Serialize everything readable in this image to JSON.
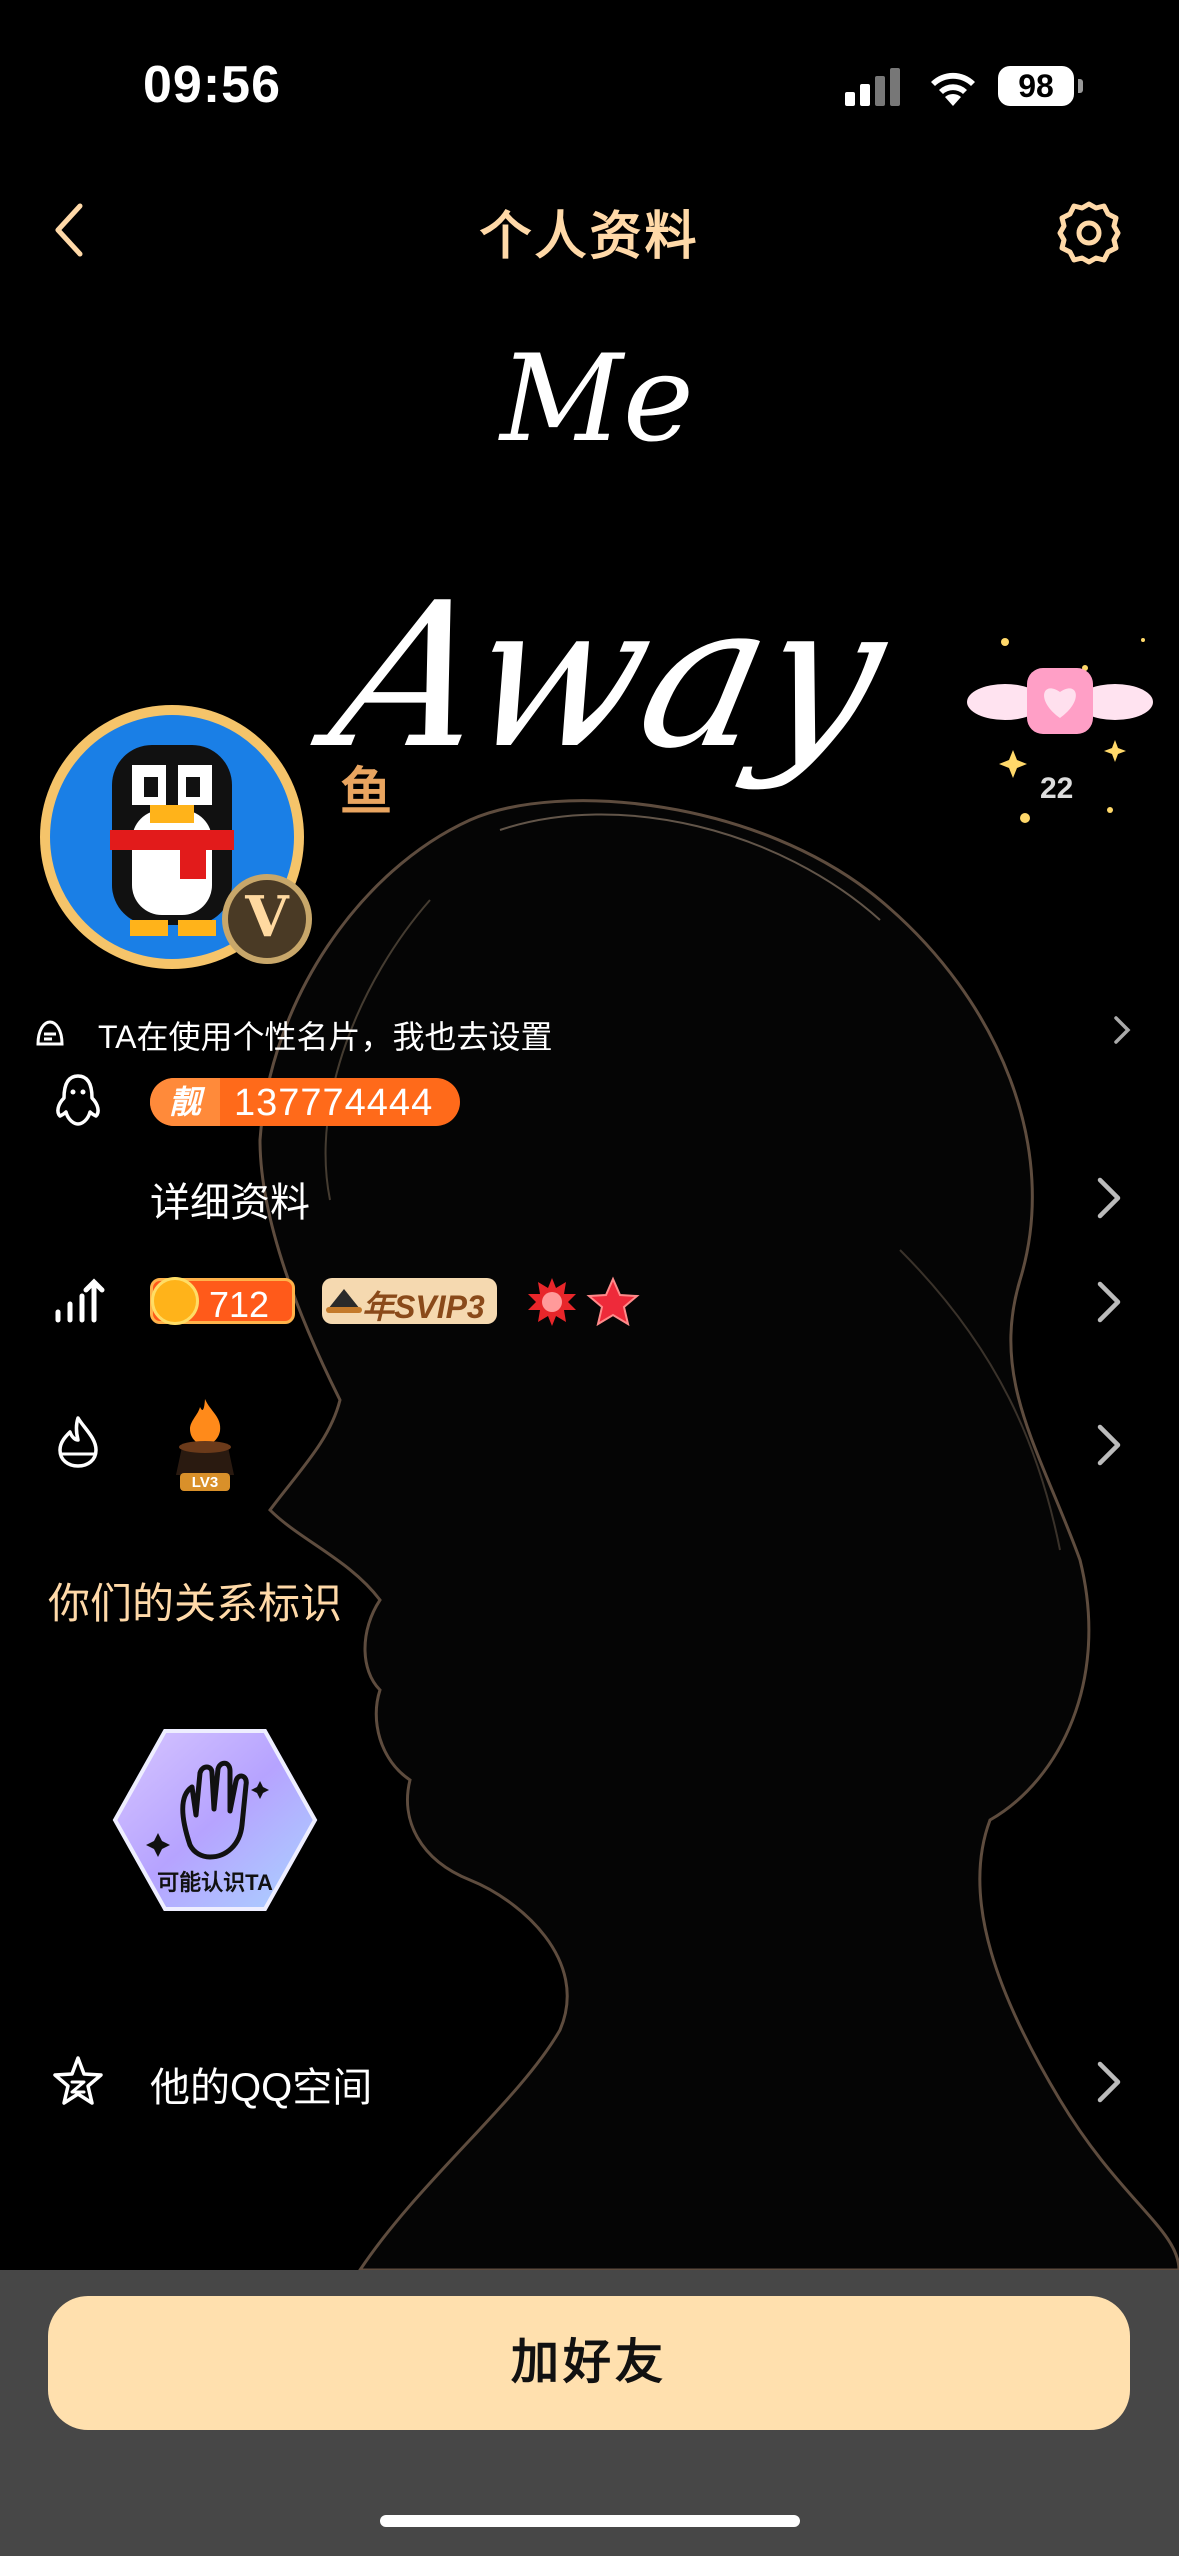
{
  "status_bar": {
    "time": "09:56",
    "battery": "98"
  },
  "header": {
    "title": "个人资料"
  },
  "hero": {
    "script_line1": "Me",
    "script_line2": "Away"
  },
  "profile": {
    "nickname": "鱼",
    "vip_letter": "V"
  },
  "gift": {
    "count": "22"
  },
  "card_hint": {
    "text": "TA在使用个性名片，我也去设置"
  },
  "qq_row": {
    "tag": "靓",
    "number": "137774444"
  },
  "details_row": {
    "label": "详细资料"
  },
  "level_row": {
    "coin_value": "712",
    "svip_label": "年SVIP3"
  },
  "fire_row": {
    "level_tag": "LV3"
  },
  "relation": {
    "section_title": "你们的关系标识",
    "badge_label": "可能认识TA"
  },
  "qzone_row": {
    "label": "他的QQ空间"
  },
  "actions": {
    "add_friend": "加好友"
  },
  "colors": {
    "accent": "#ffd9a8",
    "button_bg": "#ffe0ae",
    "bottom_bar": "#474747",
    "qq_badge": "#ff6a1a"
  }
}
